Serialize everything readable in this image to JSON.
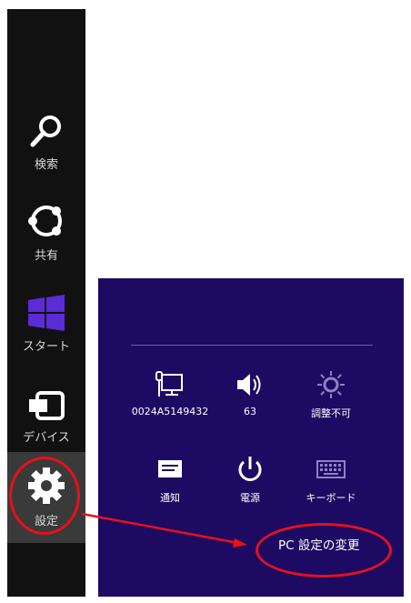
{
  "charms": {
    "search_label": "検索",
    "share_label": "共有",
    "start_label": "スタート",
    "devices_label": "デバイス",
    "settings_label": "設定"
  },
  "settings_panel": {
    "network_label": "0024A5149432",
    "volume_label": "63",
    "brightness_label": "調整不可",
    "notifications_label": "通知",
    "power_label": "電源",
    "keyboard_label": "キーボード",
    "pc_settings_label": "PC 設定の変更"
  },
  "colors": {
    "charms_bg": "#111111",
    "panel_bg": "#1c0a63",
    "start_tile": "#5b2bd6",
    "annotation_red": "#e8101a"
  }
}
